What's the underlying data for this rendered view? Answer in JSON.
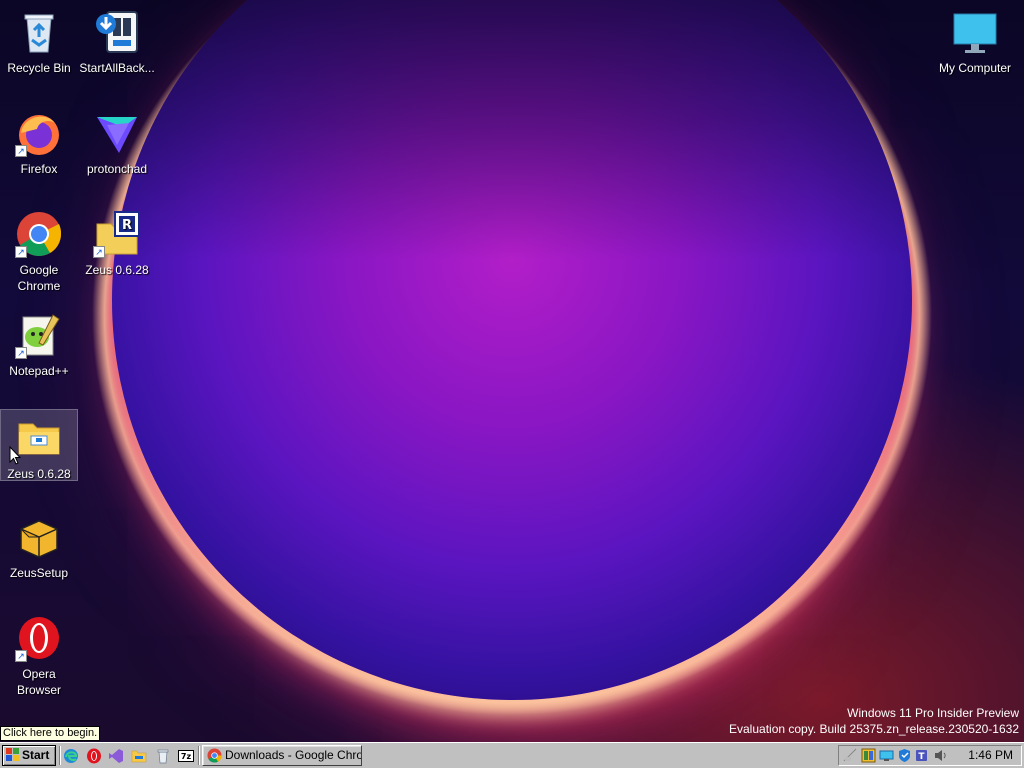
{
  "desktop": {
    "icons": [
      {
        "label": "Recycle Bin",
        "icon": "recycle-bin-icon"
      },
      {
        "label": "StartAllBack...",
        "icon": "startallback-icon"
      },
      {
        "label": "My Computer",
        "icon": "monitor-icon"
      },
      {
        "label": "Firefox",
        "icon": "firefox-icon"
      },
      {
        "label": "protonchad",
        "icon": "proton-vpn-icon"
      },
      {
        "label": "Google Chrome",
        "icon": "chrome-icon"
      },
      {
        "label": "Zeus 0.6.28",
        "icon": "zeus-shortcut-icon"
      },
      {
        "label": "Notepad++",
        "icon": "notepadpp-icon"
      },
      {
        "label": "Zeus 0.6.28",
        "icon": "folder-icon"
      },
      {
        "label": "ZeusSetup",
        "icon": "package-box-icon"
      },
      {
        "label": "Opera Browser",
        "icon": "opera-icon"
      }
    ],
    "selected_index": 8,
    "watermark_line1": "Windows 11 Pro Insider Preview",
    "watermark_line2": "Evaluation copy. Build 25375.zn_release.230520-1632"
  },
  "tooltip": "Click here to begin.",
  "taskbar": {
    "start_label": "Start",
    "quick_launch": [
      "edge-icon",
      "opera-icon",
      "visual-studio-icon",
      "file-explorer-icon",
      "recycle-bin-icon",
      "7zip-icon"
    ],
    "tasks": [
      {
        "label": "Downloads - Google Chro...",
        "icon": "chrome-icon"
      }
    ],
    "tray_icons": [
      "network-icon",
      "app-tray-icon",
      "display-tray-icon",
      "defender-shield-icon",
      "teams-icon",
      "volume-icon"
    ],
    "clock": "1:46 PM"
  },
  "colors": {
    "taskbar": "#c0c0c0",
    "tooltip_bg": "#ffffe1"
  }
}
